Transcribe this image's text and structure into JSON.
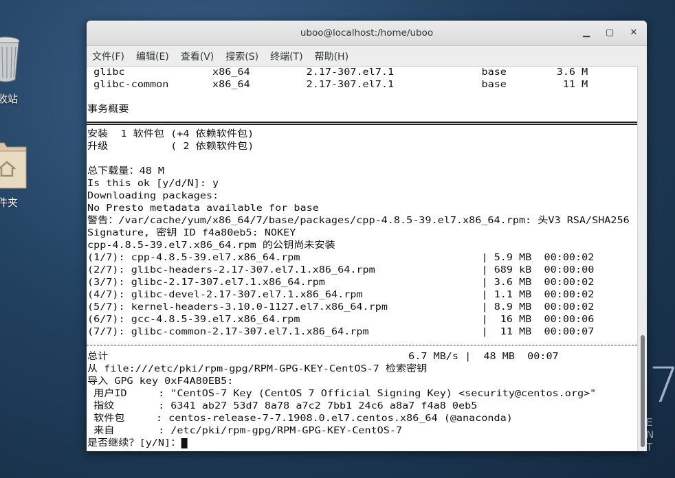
{
  "desktop": {
    "trash_label": "收站",
    "folder_label": "件夹",
    "centos_mark": "7",
    "centos_text": "E N T"
  },
  "window": {
    "title": "uboo@localhost:/home/uboo",
    "controls": {
      "minimize": "▁",
      "maximize": "▢",
      "close": "✕"
    }
  },
  "menu": [
    "文件(F)",
    "编辑(E)",
    "查看(V)",
    "搜索(S)",
    "终端(T)",
    "帮助(H)"
  ],
  "terminal": {
    "lines": [
      " glibc              x86_64         2.17-307.el7.1              base        3.6 M",
      " glibc-common       x86_64         2.17-307.el7.1              base         11 M",
      "",
      "事务概要",
      "",
      "安装  1 软件包 (+4 依赖软件包)",
      "升级          ( 2 依赖软件包)",
      "",
      "总下载量：48 M",
      "Is this ok [y/d/N]: y",
      "Downloading packages:",
      "No Presto metadata available for base",
      "警告：/var/cache/yum/x86_64/7/base/packages/cpp-4.8.5-39.el7.x86_64.rpm: 头V3 RSA/SHA256",
      "Signature, 密钥 ID f4a80eb5: NOKEY",
      "cpp-4.8.5-39.el7.x86_64.rpm 的公钥尚未安装",
      "(1/7): cpp-4.8.5-39.el7.x86_64.rpm                             | 5.9 MB  00:00:02",
      "(2/7): glibc-headers-2.17-307.el7.1.x86_64.rpm                 | 689 kB  00:00:00",
      "(3/7): glibc-2.17-307.el7.1.x86_64.rpm                         | 3.6 MB  00:00:02",
      "(4/7): glibc-devel-2.17-307.el7.1.x86_64.rpm                   | 1.1 MB  00:00:02",
      "(5/7): kernel-headers-3.10.0-1127.el7.x86_64.rpm               | 8.9 MB  00:00:02",
      "(6/7): gcc-4.8.5-39.el7.x86_64.rpm                             |  16 MB  00:00:06",
      "(7/7): glibc-common-2.17-307.el7.1.x86_64.rpm                  |  11 MB  00:00:07",
      "",
      "总计                                                6.7 MB/s |  48 MB  00:07",
      "从 file:///etc/pki/rpm-gpg/RPM-GPG-KEY-CentOS-7 检索密钥",
      "导入 GPG key 0xF4A80EB5:",
      " 用户ID     : \"CentOS-7 Key (CentOS 7 Official Signing Key) <security@centos.org>\"",
      " 指纹       : 6341 ab27 53d7 8a78 a7c2 7bb1 24c6 a8a7 f4a8 0eb5",
      " 软件包     : centos-release-7-7.1908.0.el7.centos.x86_64 (@anaconda)",
      " 来自       : /etc/pki/rpm-gpg/RPM-GPG-KEY-CentOS-7",
      "是否继续？[y/N]："
    ]
  },
  "colors": {
    "terminal_bg": "#ffffff",
    "terminal_fg": "#111111",
    "titlebar": "#e4e4e4"
  }
}
